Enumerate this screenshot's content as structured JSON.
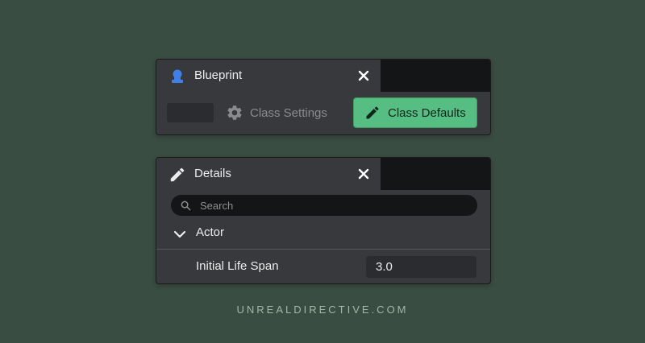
{
  "blueprint_panel": {
    "tab_title": "Blueprint",
    "class_settings_label": "Class Settings",
    "class_defaults_label": "Class Defaults"
  },
  "details_panel": {
    "tab_title": "Details",
    "search": {
      "placeholder": "Search",
      "value": ""
    },
    "category": {
      "label": "Actor",
      "expanded": true
    },
    "properties": [
      {
        "label": "Initial Life Span",
        "value": "3.0"
      }
    ]
  },
  "footer": {
    "text": "UNREALDIRECTIVE.COM"
  },
  "colors": {
    "background": "#3a4d42",
    "panel": "#38393d",
    "tab_strip": "#141517",
    "accent_green": "#56bd83",
    "blueprint_icon": "#3f7fe6"
  },
  "icons": {
    "blueprint_tab": "blueprint-icon",
    "details_tab": "pencil-icon",
    "close": "close-icon",
    "class_settings": "gear-icon",
    "class_defaults": "pencil-icon",
    "search": "search-icon",
    "category_toggle": "chevron-down-icon"
  }
}
